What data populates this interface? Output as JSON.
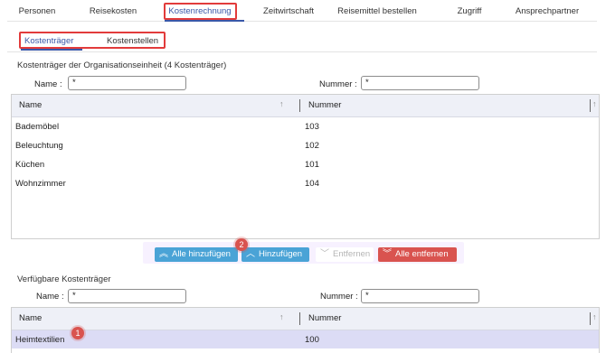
{
  "top_tabs": [
    "Personen",
    "Reisekosten",
    "Kostenrechnung",
    "Zeitwirtschaft",
    "Reisemittel bestellen",
    "Zugriff",
    "Ansprechpartner"
  ],
  "sub_tabs": [
    "Kostenträger",
    "Kostenstellen"
  ],
  "assigned": {
    "title": "Kostenträger der Organisationseinheit (4 Kostenträger)",
    "name_label": "Name :",
    "name_value": "*",
    "number_label": "Nummer :",
    "number_value": "*",
    "col_name": "Name",
    "col_number": "Nummer",
    "rows": [
      {
        "name": "Bademöbel",
        "number": "103"
      },
      {
        "name": "Beleuchtung",
        "number": "102"
      },
      {
        "name": "Küchen",
        "number": "101"
      },
      {
        "name": "Wohnzimmer",
        "number": "104"
      }
    ]
  },
  "buttons": {
    "add_all": "Alle hinzufügen",
    "add": "Hinzufügen",
    "remove": "Entfernen",
    "remove_all": "Alle entfernen"
  },
  "available": {
    "title": "Verfügbare Kostenträger",
    "name_label": "Name :",
    "name_value": "*",
    "number_label": "Nummer :",
    "number_value": "*",
    "col_name": "Name",
    "col_number": "Nummer",
    "rows": [
      {
        "name": "Heimtextilien",
        "number": "100"
      }
    ]
  },
  "badges": [
    "1",
    "2"
  ],
  "colors": {
    "accent": "#3a58a8",
    "highlight_red": "#e23b3b",
    "btn_blue": "#4aa3d6",
    "btn_grey": "#bdbdbd",
    "btn_red": "#d9534f",
    "selected_row": "#dcdcf5"
  }
}
